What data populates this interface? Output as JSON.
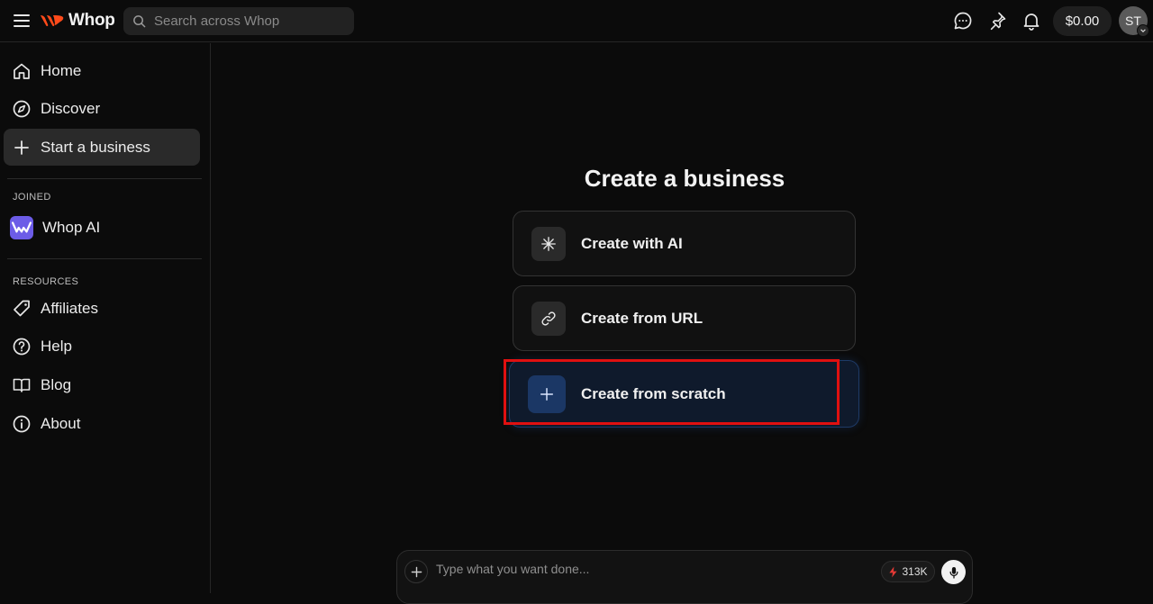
{
  "topbar": {
    "logo_text": "Whop",
    "search_placeholder": "Search across Whop",
    "balance": "$0.00",
    "avatar_initials": "ST"
  },
  "sidebar": {
    "items": [
      {
        "label": "Home",
        "icon": "home-icon"
      },
      {
        "label": "Discover",
        "icon": "compass-icon"
      },
      {
        "label": "Start a business",
        "icon": "plus-icon",
        "active": true
      }
    ],
    "joined_label": "JOINED",
    "joined": [
      {
        "label": "Whop AI",
        "icon": "whop-ai-icon"
      }
    ],
    "resources_label": "RESOURCES",
    "resources": [
      {
        "label": "Affiliates",
        "icon": "tag-icon"
      },
      {
        "label": "Help",
        "icon": "help-circle-icon"
      },
      {
        "label": "Blog",
        "icon": "book-icon"
      },
      {
        "label": "About",
        "icon": "info-icon"
      }
    ]
  },
  "main": {
    "heading": "Create a business",
    "options": [
      {
        "label": "Create with AI",
        "icon": "sparkle-icon"
      },
      {
        "label": "Create from URL",
        "icon": "link-icon"
      },
      {
        "label": "Create from scratch",
        "icon": "plus-icon",
        "selected": true
      }
    ]
  },
  "composer": {
    "placeholder": "Type what you want done...",
    "credits": "313K"
  },
  "colors": {
    "accent_blue": "#1b3765",
    "highlight_red": "#e01010",
    "credits_bolt": "#e53935"
  }
}
